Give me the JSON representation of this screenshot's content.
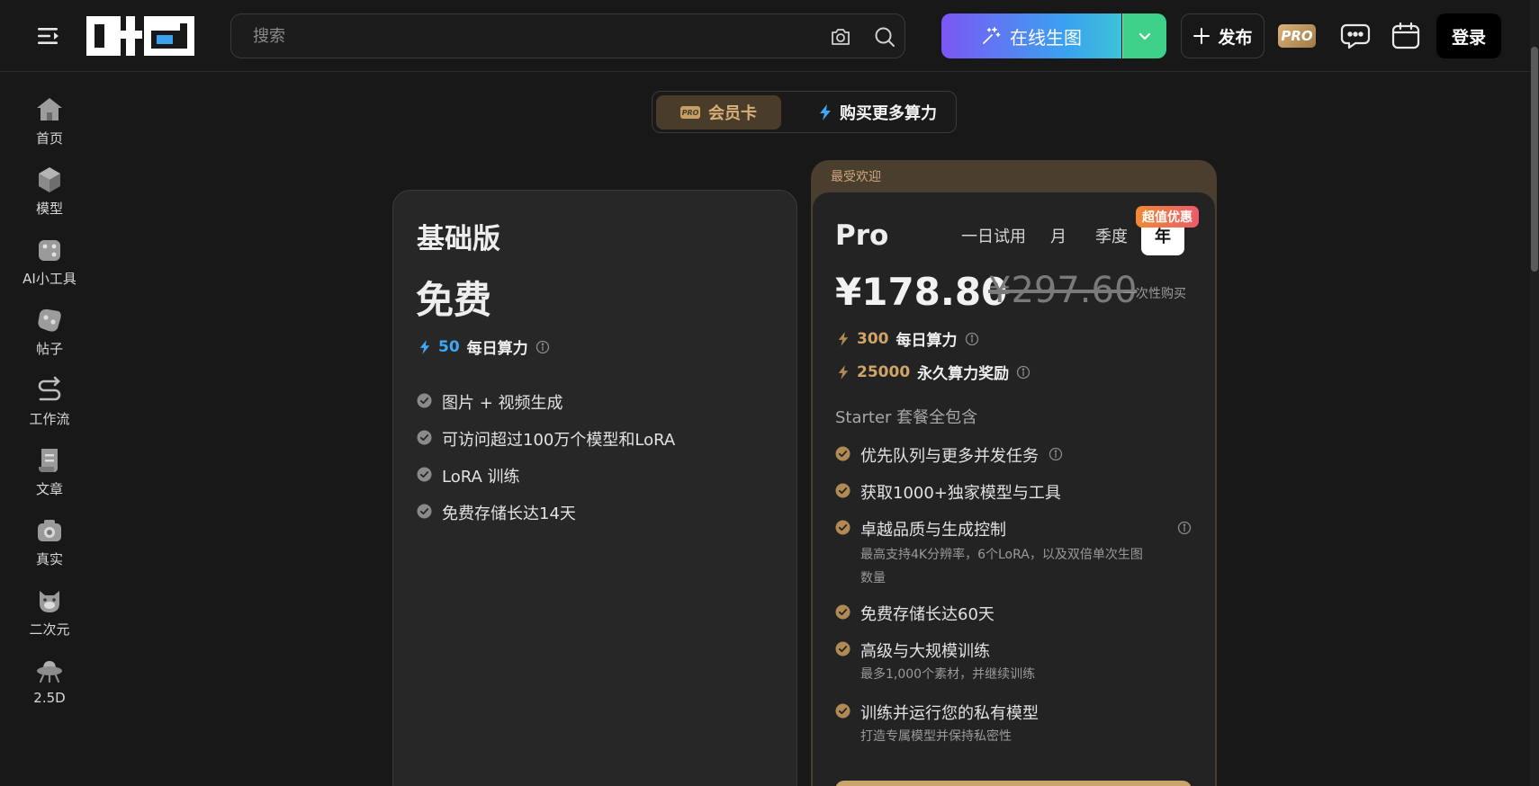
{
  "header": {
    "search_placeholder": "搜索",
    "generate_label": "在线生图",
    "publish_label": "发布",
    "pro_label": "PRO",
    "login_label": "登录"
  },
  "sidebar": {
    "items": [
      {
        "label": "首页",
        "icon": "home-icon"
      },
      {
        "label": "模型",
        "icon": "cube-icon"
      },
      {
        "label": "AI小工具",
        "icon": "dice-icon"
      },
      {
        "label": "帖子",
        "icon": "post-icon"
      },
      {
        "label": "工作流",
        "icon": "workflow-icon"
      },
      {
        "label": "文章",
        "icon": "article-icon"
      },
      {
        "label": "真实",
        "icon": "camera-icon"
      },
      {
        "label": "二次元",
        "icon": "anime-icon"
      },
      {
        "label": "2.5D",
        "icon": "ufo-icon"
      }
    ]
  },
  "tabs": {
    "member_label": "会员卡",
    "member_badge": "PRO",
    "power_label": "购买更多算力"
  },
  "basic_plan": {
    "name": "基础版",
    "price": "免费",
    "daily_amount": "50",
    "daily_label": "每日算力",
    "features": [
      "图片 + 视频生成",
      "可访问超过100万个模型和LoRA",
      "LoRA 训练",
      "免费存储长达14天"
    ]
  },
  "pro_plan": {
    "popular_label": "最受欢迎",
    "name": "Pro",
    "periods": [
      "一日试用",
      "月",
      "季度",
      "年"
    ],
    "active_period": "年",
    "deal_badge": "超值优惠",
    "price": "¥178.80",
    "original_price": "¥297.60",
    "purchase_type": "一次性购买",
    "daily_amount": "300",
    "daily_label": "每日算力",
    "permanent_amount": "25000",
    "permanent_label": "永久算力奖励",
    "includes_label": "Starter 套餐全包含",
    "features": [
      {
        "title": "优先队列与更多并发任务",
        "sub": ""
      },
      {
        "title": "获取1000+独家模型与工具",
        "sub": ""
      },
      {
        "title": "卓越品质与生成控制",
        "sub": "最高支持4K分辨率，6个LoRA，以及双倍单次生图数量"
      },
      {
        "title": "免费存储长达60天",
        "sub": ""
      },
      {
        "title": "高级与大规模训练",
        "sub": "最多1,000个素材，并继续训练"
      },
      {
        "title": "训练并运行您的私有模型",
        "sub": "打造专属模型并保持私密性"
      }
    ]
  },
  "colors": {
    "accent_gold": "#c9a46b",
    "accent_blue": "#3da8f5",
    "background": "#181818"
  }
}
